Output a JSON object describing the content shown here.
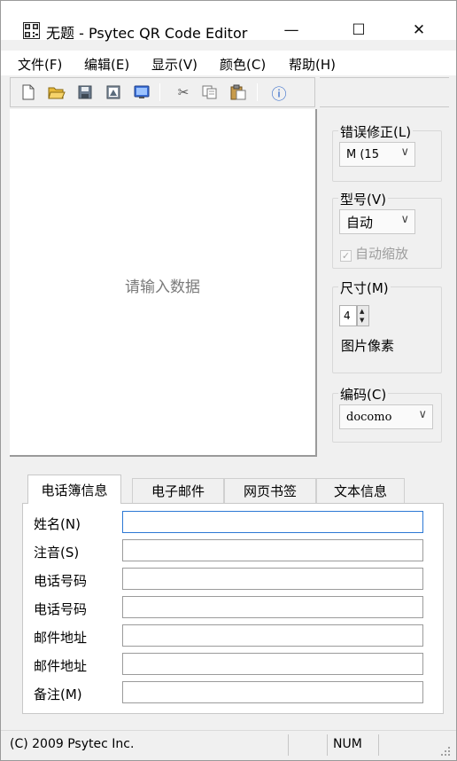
{
  "window": {
    "title": "无题 - Psytec QR Code Editor",
    "controls": {
      "minimize": "—",
      "maximize": "☐",
      "close": "✕"
    },
    "icon": "qr-app-icon"
  },
  "menu": {
    "items": [
      "文件(F)",
      "编辑(E)",
      "显示(V)",
      "颜色(C)",
      "帮助(H)"
    ]
  },
  "toolbar": {
    "buttons": [
      "new-file-icon",
      "open-folder-icon",
      "save-icon",
      "save-image-icon",
      "display-icon",
      "cut-icon",
      "copy-icon",
      "paste-icon",
      "info-icon"
    ],
    "info_glyph": "ⓘ",
    "cut_glyph": "✂"
  },
  "canvas": {
    "placeholder": "请输入数据"
  },
  "settings": {
    "error_correction": {
      "label": "错误修正(L)",
      "value": "M (15"
    },
    "model": {
      "label": "型号(V)",
      "value": "自动"
    },
    "auto_zoom": {
      "label": "自动缩放",
      "checked": true,
      "enabled": false
    },
    "size": {
      "label": "尺寸(M)",
      "value": "4",
      "unit": "图片像素"
    },
    "encoding": {
      "label": "编码(C)",
      "value": "docomo"
    },
    "dropdown_glyph": "∨"
  },
  "tabs": {
    "items": [
      "电话簿信息",
      "电子邮件",
      "网页书签",
      "文本信息"
    ],
    "active_index": 0
  },
  "form": {
    "fields": [
      {
        "label": "姓名(N)",
        "value": ""
      },
      {
        "label": "注音(S)",
        "value": ""
      },
      {
        "label": "电话号码",
        "value": ""
      },
      {
        "label": "电话号码",
        "value": ""
      },
      {
        "label": "邮件地址",
        "value": ""
      },
      {
        "label": "邮件地址",
        "value": ""
      },
      {
        "label": "备注(M)",
        "value": ""
      }
    ]
  },
  "status": {
    "copyright": "(C) 2009 Psytec Inc.",
    "num_lock": "NUM"
  },
  "colors": {
    "window_bg": "#f0f0f0",
    "focus_border": "#2c78d4",
    "disabled_text": "#9e9e9e",
    "placeholder_text": "#7a7a7a"
  }
}
